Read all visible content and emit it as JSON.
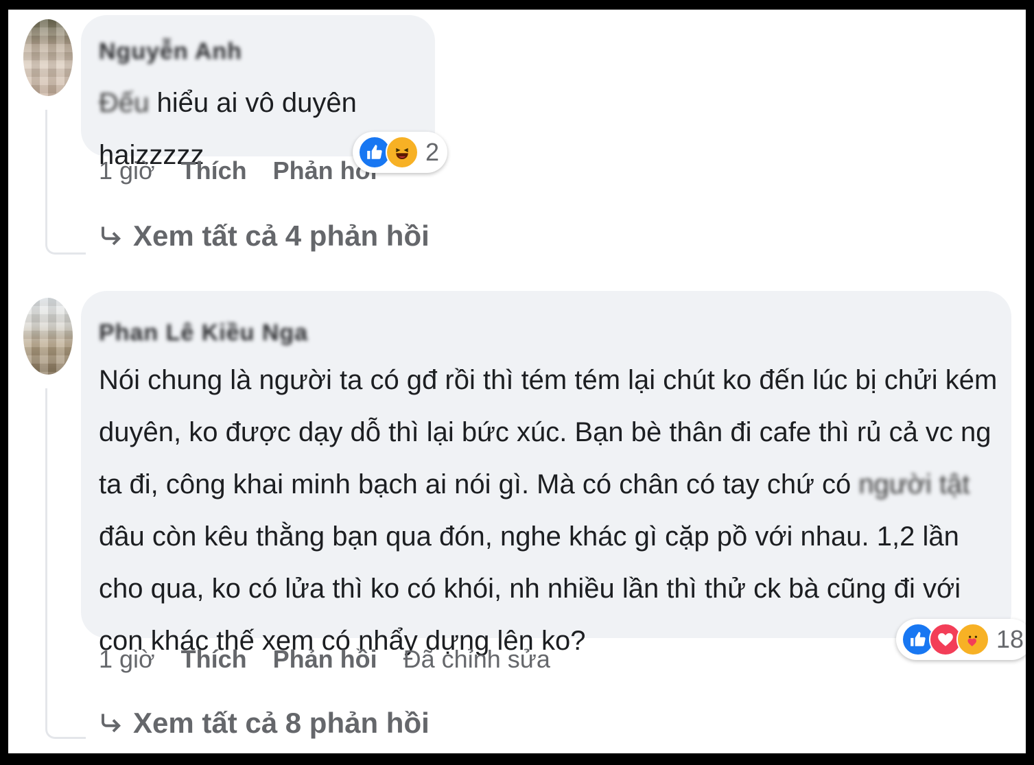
{
  "comments": [
    {
      "author": "Nguyễn Anh",
      "text_blurred_prefix": "Đếu",
      "text": " hiểu ai vô duyên haizzzzz",
      "time": "1 giờ",
      "like_label": "Thích",
      "reply_label": "Phản hồi",
      "reaction_icons": [
        "like-icon",
        "haha-icon"
      ],
      "reaction_count": "2",
      "view_replies": "Xem tất cả 4 phản hồi"
    },
    {
      "author": "Phan Lê Kiều Nga",
      "text_part1": "Nói chung là người ta có gđ rồi thì tém tém lại chút ko đến lúc bị chửi kém duyên, ko được dạy dỗ thì lại bức xúc. Bạn bè thân đi cafe thì rủ cả vc ng ta đi, công khai minh bạch ai nói gì. Mà có chân có tay chứ có ",
      "text_blurred": "người tật",
      "text_part2": " đâu còn kêu thằng bạn qua đón, nghe khác gì cặp pồ với nhau. 1,2 lần cho qua, ko có lửa thì ko có khói, nh nhiều lần thì thử ck bà cũng đi với con khác thế xem có nhẩy dựng lên ko?",
      "time": "1 giờ",
      "like_label": "Thích",
      "reply_label": "Phản hồi",
      "edited_label": "Đã chỉnh sửa",
      "reaction_icons": [
        "like-icon",
        "love-icon",
        "care-icon"
      ],
      "reaction_count": "18",
      "view_replies": "Xem tất cả 8 phản hồi"
    }
  ],
  "colors": {
    "bubble": "#f0f2f5",
    "secondary_text": "#65676b",
    "like_blue": "#1877f2",
    "love_red": "#f33e58",
    "haha_yellow": "#f7b125"
  }
}
